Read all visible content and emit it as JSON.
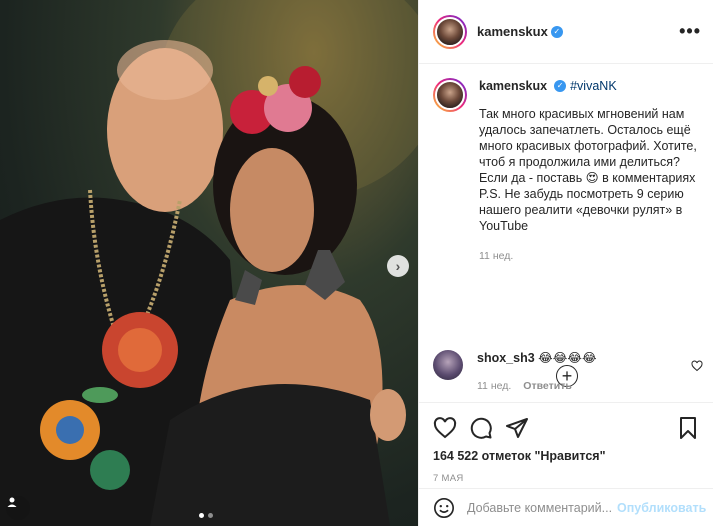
{
  "post": {
    "username": "kamenskux",
    "verified": true,
    "hashtag": "#vivaNK",
    "caption": "Так много красивых мгновений нам удалось запечатлеть. Осталось ещё много красивых фотографий. Хотите, чтоб я продолжила ими делиться? Если да - поставь 😍 в комментариях\nP.S. Не забудь посмотреть 9 серию нашего реалити «девочки рулят» в YouTube",
    "caption_age": "11 нед.",
    "likes_text": "164 522 отметок \"Нравится\"",
    "date": "7 МАЯ"
  },
  "carousel": {
    "next_icon": "chevron-right-icon",
    "dots": 2,
    "active_dot": 0
  },
  "comments": [
    {
      "username": "shox_sh3",
      "text": "😂😂😂😂",
      "age": "11 нед.",
      "reply_label": "Ответить"
    }
  ],
  "composer": {
    "placeholder": "Добавьте комментарий...",
    "publish_label": "Опубликовать"
  },
  "icons": [
    "more-icon",
    "heart-icon",
    "comment-icon",
    "share-icon",
    "bookmark-icon",
    "smile-icon",
    "plus-circle-icon",
    "user-tag-icon"
  ],
  "colors": {
    "link": "#00376b",
    "verified": "#3897f0",
    "publish_disabled": "#b2dffc",
    "muted": "#8e8e8e"
  }
}
